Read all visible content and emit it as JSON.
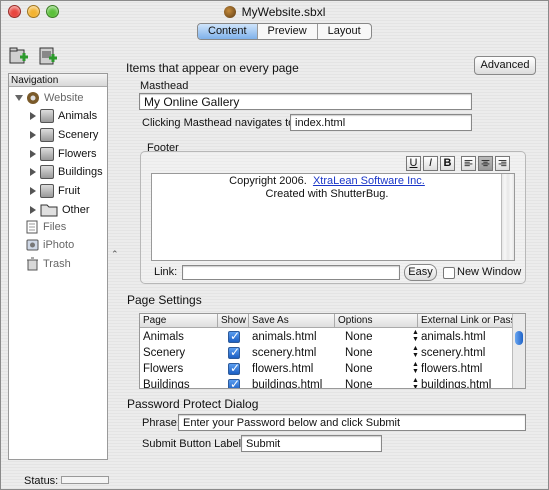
{
  "window": {
    "title": "MyWebsite.sbxl",
    "traffic_light_colors": [
      "#e9463f",
      "#f3b331",
      "#5bc03a"
    ]
  },
  "tabs": [
    {
      "label": "Content",
      "active": true
    },
    {
      "label": "Preview",
      "active": false
    },
    {
      "label": "Layout",
      "active": false
    }
  ],
  "sidebar": {
    "header": "Navigation",
    "root": "Website",
    "items": [
      "Animals",
      "Scenery",
      "Flowers",
      "Buildings",
      "Fruit",
      "Other"
    ],
    "extras": [
      "Files",
      "iPhoto",
      "Trash"
    ]
  },
  "main": {
    "section_title": "Items that appear on every page",
    "advanced_button": "Advanced",
    "masthead_label": "Masthead",
    "masthead_value": "My Online Gallery",
    "nav_label": "Clicking Masthead navigates to:",
    "nav_value": "index.html",
    "footer": {
      "title": "Footer",
      "format_buttons": [
        "U",
        "I",
        "B"
      ],
      "line1_prefix": "Copyright 2006.  ",
      "line1_link": "XtraLean Software Inc.",
      "line2": "Created with ShutterBug.",
      "link_label": "Link:",
      "link_value": "",
      "easy_button": "Easy",
      "new_window_label": "New Window"
    }
  },
  "page_settings": {
    "title": "Page Settings",
    "columns": [
      "Page",
      "Show",
      "Save As",
      "Options",
      "External Link or Passw"
    ],
    "rows": [
      {
        "page": "Animals",
        "show": true,
        "save_as": "animals.html",
        "options": "None",
        "external": "animals.html"
      },
      {
        "page": "Scenery",
        "show": true,
        "save_as": "scenery.html",
        "options": "None",
        "external": "scenery.html"
      },
      {
        "page": "Flowers",
        "show": true,
        "save_as": "flowers.html",
        "options": "None",
        "external": "flowers.html"
      },
      {
        "page": "Buildings",
        "show": true,
        "save_as": "buildings.html",
        "options": "None",
        "external": "buildings.html"
      }
    ]
  },
  "password_dialog": {
    "title": "Password Protect Dialog",
    "phrase_label": "Phrase:",
    "phrase_value": "Enter your Password below and click Submit",
    "submit_label": "Submit Button Label:",
    "submit_value": "Submit"
  },
  "status": {
    "label": "Status:"
  }
}
